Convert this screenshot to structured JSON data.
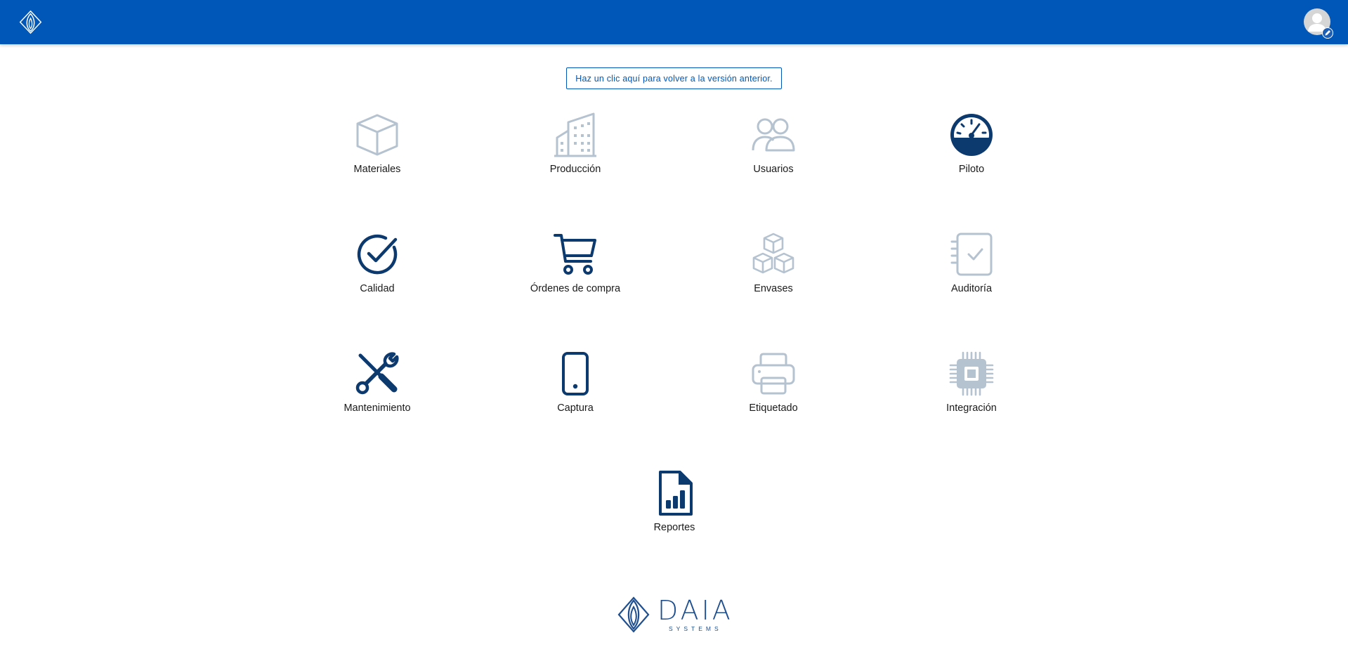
{
  "header": {
    "logo_icon": "daia-flame-icon",
    "avatar_icon": "user-avatar-icon",
    "brand_color": "#0057b8"
  },
  "legacy_link": {
    "label": "Haz un clic aquí para volver a la versión anterior."
  },
  "modules": [
    {
      "label": "Materiales",
      "icon": "box-icon",
      "active": false
    },
    {
      "label": "Producción",
      "icon": "building-icon",
      "active": false
    },
    {
      "label": "Usuarios",
      "icon": "users-icon",
      "active": false
    },
    {
      "label": "Piloto",
      "icon": "gauge-icon",
      "active": true
    },
    {
      "label": "Calidad",
      "icon": "check-circle-icon",
      "active": true
    },
    {
      "label": "Órdenes de compra",
      "icon": "shopping-cart-icon",
      "active": true
    },
    {
      "label": "Envases",
      "icon": "cubes-icon",
      "active": false
    },
    {
      "label": "Auditoría",
      "icon": "checklist-icon",
      "active": false
    },
    {
      "label": "Mantenimiento",
      "icon": "tools-icon",
      "active": true
    },
    {
      "label": "Captura",
      "icon": "mobile-phone-icon",
      "active": true
    },
    {
      "label": "Etiquetado",
      "icon": "printer-icon",
      "active": false
    },
    {
      "label": "Integración",
      "icon": "chip-icon",
      "active": false
    },
    {
      "label": "Reportes",
      "icon": "report-file-icon",
      "active": true
    }
  ],
  "footer": {
    "brand": "DAIA",
    "brand_sub": "SYSTEMS"
  },
  "colors": {
    "active_icon": "#0d3a6e",
    "inactive_icon": "#b5c2d0"
  }
}
